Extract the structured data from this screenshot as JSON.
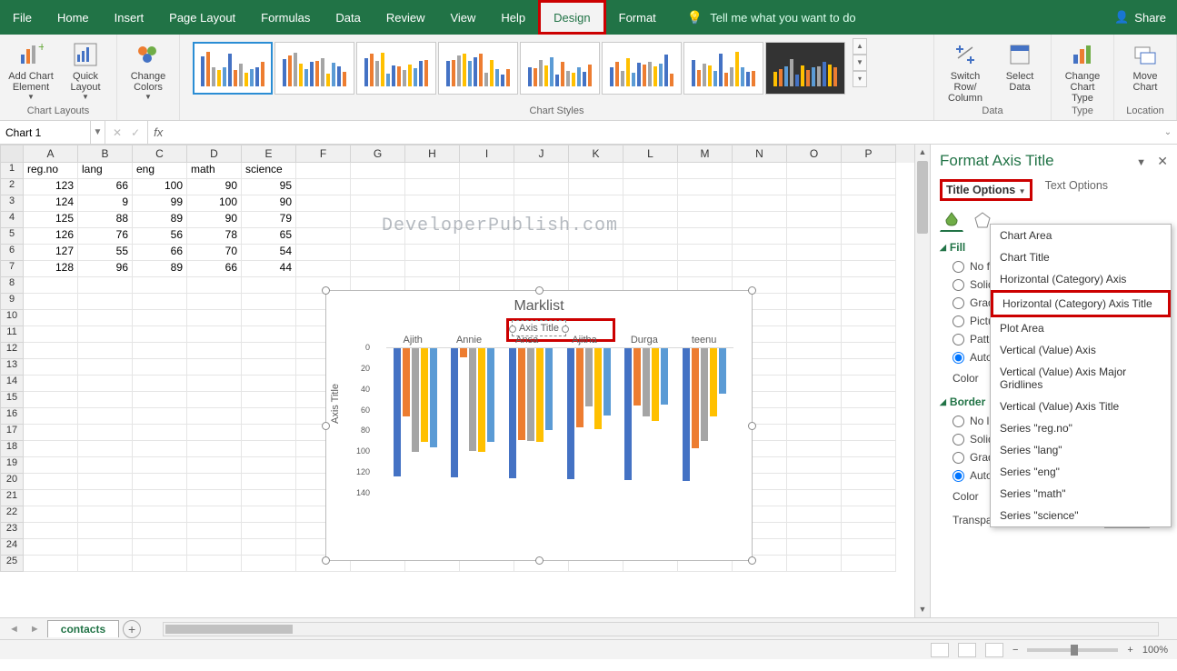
{
  "ribbon": {
    "tabs": [
      "File",
      "Home",
      "Insert",
      "Page Layout",
      "Formulas",
      "Data",
      "Review",
      "View",
      "Help",
      "Design",
      "Format"
    ],
    "active_tab": "Design",
    "tell_me": "Tell me what you want to do",
    "share": "Share"
  },
  "ribbon_groups": {
    "chart_layouts": "Chart Layouts",
    "add_chart_element": "Add Chart Element",
    "quick_layout": "Quick Layout",
    "change_colors": "Change Colors",
    "chart_styles": "Chart Styles",
    "switch_row_col": "Switch Row/ Column",
    "select_data": "Select Data",
    "data": "Data",
    "change_chart_type": "Change Chart Type",
    "type": "Type",
    "move_chart": "Move Chart",
    "location": "Location"
  },
  "name_box": "Chart 1",
  "columns": [
    "A",
    "B",
    "C",
    "D",
    "E",
    "F",
    "G",
    "H",
    "I",
    "J",
    "K",
    "L",
    "M",
    "N",
    "O",
    "P"
  ],
  "headers": [
    "reg.no",
    "lang",
    "eng",
    "math",
    "science"
  ],
  "table_rows": [
    [
      123,
      66,
      100,
      90,
      95
    ],
    [
      124,
      9,
      99,
      100,
      90
    ],
    [
      125,
      88,
      89,
      90,
      79
    ],
    [
      126,
      76,
      56,
      78,
      65
    ],
    [
      127,
      55,
      66,
      70,
      54
    ],
    [
      128,
      96,
      89,
      66,
      44
    ]
  ],
  "watermark": "DeveloperPublish.com",
  "chart": {
    "title": "Marklist",
    "axis_title_placeholder": "Axis Title",
    "y_axis_title": "Axis Title",
    "categories": [
      "Ajith",
      "Annie",
      "Ansa",
      "Ajitha",
      "Durga",
      "teenu"
    ]
  },
  "chart_data": {
    "type": "bar",
    "title": "Marklist",
    "xlabel": "Axis Title",
    "ylabel": "Axis Title",
    "ylim": [
      0,
      140
    ],
    "y_reversed": true,
    "y_ticks": [
      0,
      20,
      40,
      60,
      80,
      100,
      120,
      140
    ],
    "categories": [
      "Ajith",
      "Annie",
      "Ansa",
      "Ajitha",
      "Durga",
      "teenu"
    ],
    "series": [
      {
        "name": "reg.no",
        "color": "#4472C4",
        "values": [
          123,
          124,
          125,
          126,
          127,
          128
        ]
      },
      {
        "name": "lang",
        "color": "#ED7D31",
        "values": [
          66,
          9,
          88,
          76,
          55,
          96
        ]
      },
      {
        "name": "eng",
        "color": "#A5A5A5",
        "values": [
          100,
          99,
          89,
          56,
          66,
          89
        ]
      },
      {
        "name": "math",
        "color": "#FFC000",
        "values": [
          90,
          100,
          90,
          78,
          70,
          66
        ]
      },
      {
        "name": "science",
        "color": "#5B9BD5",
        "values": [
          95,
          90,
          79,
          65,
          54,
          44
        ]
      }
    ]
  },
  "format_pane": {
    "title": "Format Axis Title",
    "tab_title_options": "Title Options",
    "tab_text_options": "Text Options",
    "fill": "Fill",
    "no_fill": "No fill",
    "solid_fill": "Solid fill",
    "gradient_fill": "Gradient fill",
    "picture_fill": "Picture or texture fill",
    "pattern_fill": "Pattern fill",
    "automatic": "Automatic",
    "color": "Color",
    "border": "Border",
    "no_line": "No line",
    "solid_line": "Solid line",
    "gradient_line": "Gradient line",
    "transparency": "Transparency"
  },
  "element_dropdown": [
    "Chart Area",
    "Chart Title",
    "Horizontal (Category) Axis",
    "Horizontal (Category) Axis Title",
    "Plot Area",
    "Vertical (Value) Axis",
    "Vertical (Value) Axis Major Gridlines",
    "Vertical (Value) Axis Title",
    "Series \"reg.no\"",
    "Series \"lang\"",
    "Series \"eng\"",
    "Series \"math\"",
    "Series \"science\""
  ],
  "sheet_tab": "contacts",
  "zoom": "100%"
}
